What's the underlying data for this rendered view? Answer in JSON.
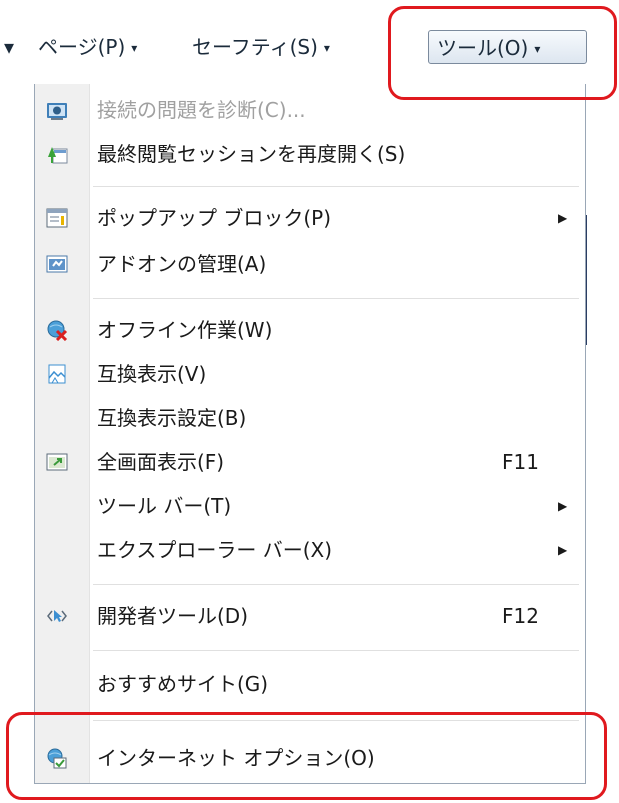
{
  "toolbar": {
    "prev_arrow": "▾",
    "page": "ページ(P)",
    "safety": "セーフティ(S)",
    "tools": "ツール(O)",
    "arrow": "▾"
  },
  "menu": {
    "diagnose": "接続の問題を診断(C)...",
    "reopen": "最終閲覧セッションを再度開く(S)",
    "popup": "ポップアップ ブロック(P)",
    "addons": "アドオンの管理(A)",
    "offline": "オフライン作業(W)",
    "compat": "互換表示(V)",
    "compat_settings": "互換表示設定(B)",
    "fullscreen": "全画面表示(F)",
    "fullscreen_key": "F11",
    "toolbars": "ツール バー(T)",
    "explorer_bars": "エクスプローラー バー(X)",
    "devtools": "開発者ツール(D)",
    "devtools_key": "F12",
    "suggested": "おすすめサイト(G)",
    "internet_options": "インターネット オプション(O)",
    "submenu_arrow": "▶"
  },
  "colors": {
    "highlight": "#e0191e",
    "disabled_text": "#a0a0a0",
    "gutter": "#f0f0f0"
  },
  "icons": [
    "diagnose-icon",
    "reopen-session-icon",
    "popup-blocker-icon",
    "addons-icon",
    "offline-icon",
    "compat-view-icon",
    "fullscreen-icon",
    "devtools-icon",
    "internet-options-icon"
  ]
}
